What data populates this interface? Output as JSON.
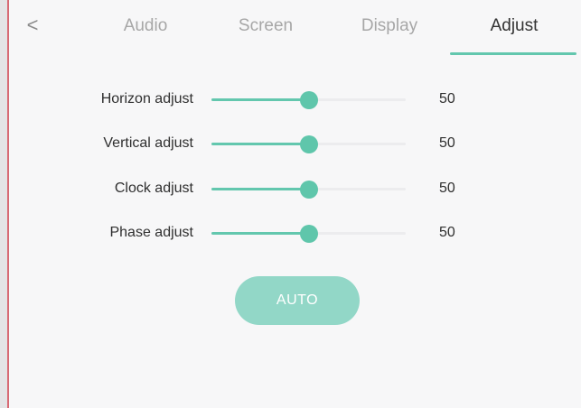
{
  "header": {
    "back_glyph": "<",
    "tabs": [
      {
        "label": "Audio",
        "active": false
      },
      {
        "label": "Screen",
        "active": false
      },
      {
        "label": "Display",
        "active": false
      },
      {
        "label": "Adjust",
        "active": true
      }
    ]
  },
  "adjustments": [
    {
      "label": "Horizon adjust",
      "value": "50",
      "fraction": 0.5
    },
    {
      "label": "Vertical adjust",
      "value": "50",
      "fraction": 0.5
    },
    {
      "label": "Clock adjust",
      "value": "50",
      "fraction": 0.5
    },
    {
      "label": "Phase adjust",
      "value": "50",
      "fraction": 0.5
    }
  ],
  "auto_button": {
    "label": "AUTO"
  },
  "colors": {
    "accent": "#63c7ae",
    "button": "#92d7c7",
    "active_tab_text": "#333333",
    "inactive_tab_text": "#a7a7a7"
  }
}
